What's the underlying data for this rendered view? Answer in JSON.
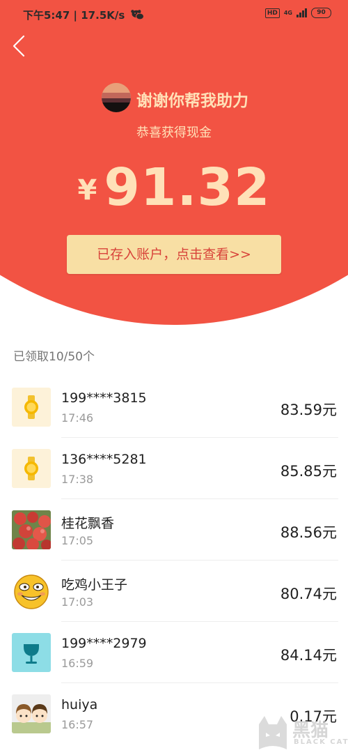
{
  "status_bar": {
    "time": "下午5:47",
    "speed": "17.5K/s",
    "hd": "HD",
    "network": "4G",
    "battery": "90"
  },
  "header": {
    "sender_title": "谢谢你帮我助力",
    "subtitle": "恭喜获得现金",
    "currency": "¥",
    "amount": "91.32",
    "cta_label": "已存入账户，点击查看>>"
  },
  "claims": {
    "summary": "已领取10/50个",
    "items": [
      {
        "name": "199****3815",
        "time": "17:46",
        "amount": "83.59元",
        "avatar": "watch-icon"
      },
      {
        "name": "136****5281",
        "time": "17:38",
        "amount": "85.85元",
        "avatar": "watch-icon"
      },
      {
        "name": "桂花飘香",
        "time": "17:05",
        "amount": "88.56元",
        "avatar": "apple-photo"
      },
      {
        "name": "吃鸡小王子",
        "time": "17:03",
        "amount": "80.74元",
        "avatar": "emoji-face"
      },
      {
        "name": "199****2979",
        "time": "16:59",
        "amount": "84.14元",
        "avatar": "cup-icon"
      },
      {
        "name": "huiya",
        "time": "16:57",
        "amount": "0.17元",
        "avatar": "cartoon-kids"
      }
    ]
  },
  "colors": {
    "header_red": "#f25343",
    "gold_text": "#ffe1b8",
    "button_bg": "#f8dfa4",
    "button_text": "#d8433a"
  },
  "watermark": {
    "title": "黑猫",
    "subtitle": "BLACK CAT"
  }
}
